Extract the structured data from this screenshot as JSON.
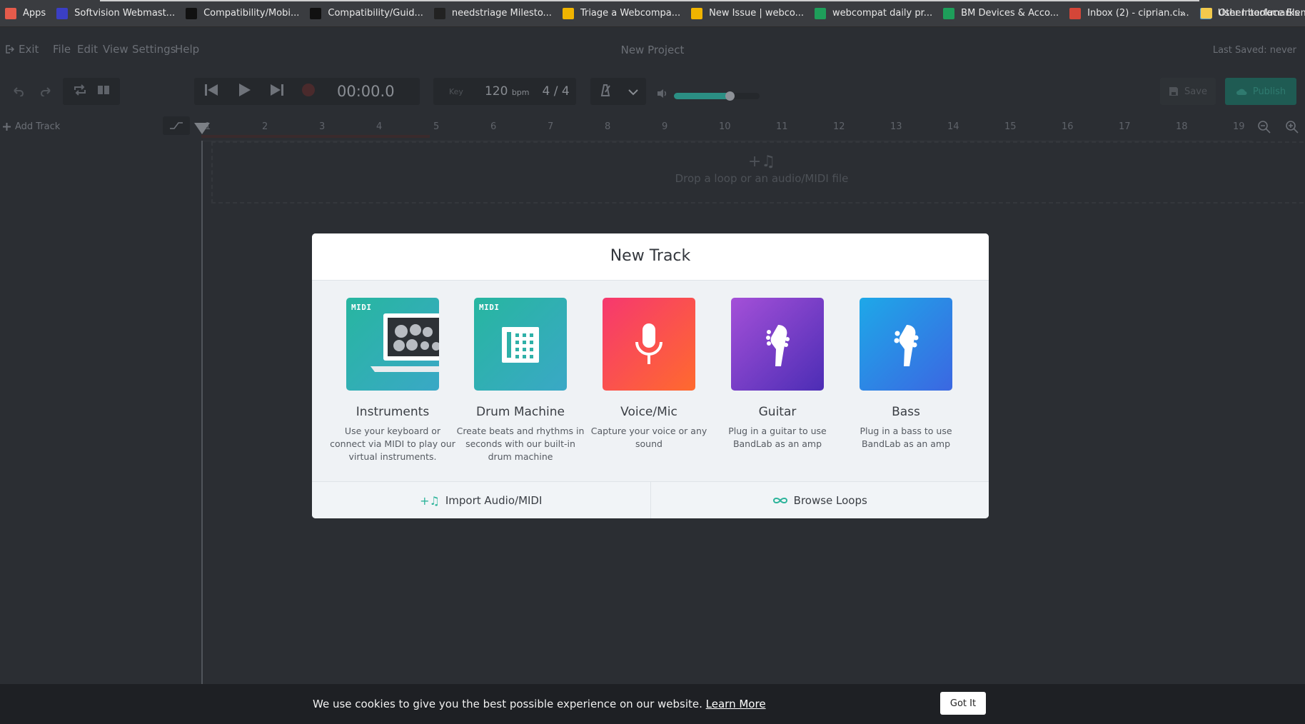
{
  "bookmarks": {
    "items": [
      {
        "label": "Apps",
        "icon": "apps-grid-icon",
        "color": "#e55b4b"
      },
      {
        "label": "Softvision Webmast...",
        "icon": "softvision-icon",
        "color": "#3b3fc4"
      },
      {
        "label": "Compatibility/Mobi...",
        "icon": "mozilla-wiki-icon",
        "color": "#111111"
      },
      {
        "label": "Compatibility/Guid...",
        "icon": "mozilla-wiki-icon",
        "color": "#111111"
      },
      {
        "label": "needstriage Milesto...",
        "icon": "github-icon",
        "color": "#222222"
      },
      {
        "label": "Triage a Webcompa...",
        "icon": "webcompat-icon",
        "color": "#f0b400"
      },
      {
        "label": "New Issue | webco...",
        "icon": "webcompat-icon",
        "color": "#f0b400"
      },
      {
        "label": "webcompat daily pr...",
        "icon": "sheets-icon",
        "color": "#1e9e5a"
      },
      {
        "label": "BM Devices & Acco...",
        "icon": "sheets-icon",
        "color": "#1e9e5a"
      },
      {
        "label": "Inbox (2) - ciprian.ci...",
        "icon": "gmail-icon",
        "color": "#d44638"
      },
      {
        "label": "User Interface Elem...",
        "icon": "dev-icon",
        "color": "#4aa0d8"
      }
    ],
    "more": "»",
    "other": "Other bookmarks"
  },
  "menubar": {
    "exit": "Exit",
    "file": "File",
    "edit": "Edit",
    "view": "View",
    "settings": "Settings",
    "help": "Help",
    "project_title": "New Project",
    "last_saved": "Last Saved: never"
  },
  "toolbar": {
    "time": "00:00.0",
    "key": "Key",
    "bpm": "120",
    "bpm_unit": "bpm",
    "time_signature": "4 / 4",
    "volume": 0.65,
    "save": "Save",
    "publish": "Publish"
  },
  "tracks": {
    "add_track": "Add Track"
  },
  "ruler": {
    "ticks": [
      "1",
      "2",
      "3",
      "4",
      "5",
      "6",
      "7",
      "8",
      "9",
      "10",
      "11",
      "12",
      "13",
      "14",
      "15",
      "16",
      "17",
      "18",
      "19"
    ]
  },
  "dropzone": {
    "text": "Drop a loop or an audio/MIDI file"
  },
  "modal": {
    "title": "New Track",
    "badge": "MIDI",
    "cards": [
      {
        "name": "Instruments",
        "desc": "Use your keyboard or connect via MIDI to play our virtual instruments.",
        "gradient_from": "#27b6a0",
        "gradient_to": "#3aa8c6"
      },
      {
        "name": "Drum Machine",
        "desc": "Create beats and rhythms in seconds with our built-in drum machine",
        "gradient_from": "#27b6a0",
        "gradient_to": "#3aa8c6"
      },
      {
        "name": "Voice/Mic",
        "desc": "Capture your voice or any sound",
        "gradient_from": "#f6386f",
        "gradient_to": "#ff6a2e"
      },
      {
        "name": "Guitar",
        "desc": "Plug in a guitar to use BandLab as an amp",
        "gradient_from": "#a450d8",
        "gradient_to": "#4c2db5"
      },
      {
        "name": "Bass",
        "desc": "Plug in a bass to use BandLab as an amp",
        "gradient_from": "#1ea8e8",
        "gradient_to": "#3b67e2"
      }
    ],
    "import_label": "Import Audio/MIDI",
    "browse_label": "Browse Loops",
    "accent": "#2bb39a"
  },
  "cookie": {
    "message": "We use cookies to give you the best possible experience on our website.",
    "learn_more": "Learn More",
    "got_it": "Got It"
  }
}
